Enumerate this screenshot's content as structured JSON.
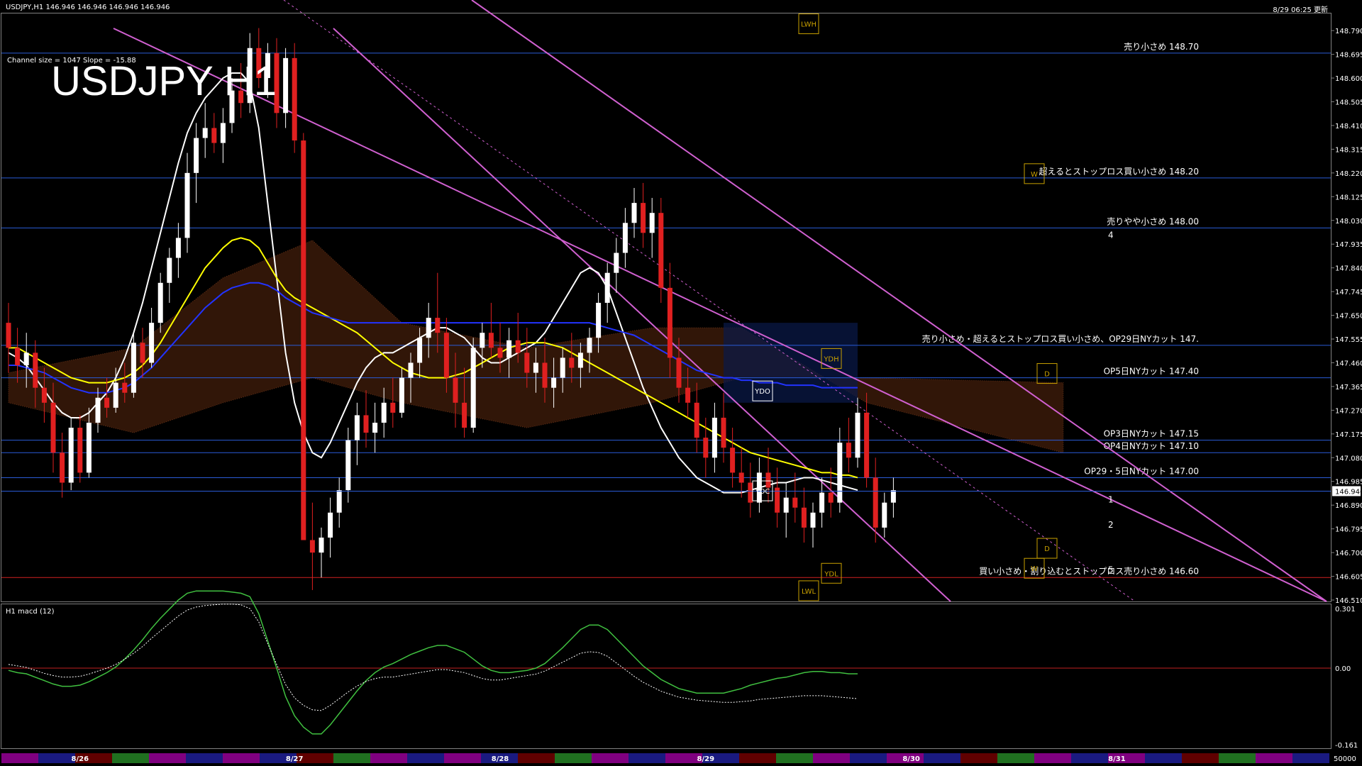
{
  "header": {
    "symbol_ohlc": "USDJPY,H1  146.946 146.946 146.946 146.946",
    "timestamp": "8/29 06:25 更新",
    "channel_info": "Channel size = 1047 Slope = -15.88",
    "title": "USDJPY H1"
  },
  "macd_panel": {
    "title": "H1  macd (12)",
    "y_labels": [
      "0.301",
      "0.00",
      "-0.161"
    ]
  },
  "volume_axis_label": "50000",
  "chart_data": {
    "type": "candlestick",
    "symbol": "USDJPY",
    "timeframe": "H1",
    "ylim": [
      146.51,
      148.85
    ],
    "y_ticks": [
      "148.790",
      "148.695",
      "148.600",
      "148.505",
      "148.410",
      "148.315",
      "148.220",
      "148.125",
      "148.030",
      "147.935",
      "147.840",
      "147.745",
      "147.650",
      "147.555",
      "147.460",
      "147.365",
      "147.270",
      "147.175",
      "147.080",
      "146.985",
      "146.890",
      "146.795",
      "146.700",
      "146.605",
      "146.510"
    ],
    "current_price": "146.946",
    "x_labels": [
      {
        "text": "8/26",
        "bar": 8
      },
      {
        "text": "8/27",
        "bar": 32
      },
      {
        "text": "8/28",
        "bar": 55
      },
      {
        "text": "8/29",
        "bar": 78
      },
      {
        "text": "8/30",
        "bar": 101
      },
      {
        "text": "8/31",
        "bar": 124
      }
    ],
    "candles": [
      [
        147.62,
        147.7,
        147.42,
        147.52
      ],
      [
        147.52,
        147.6,
        147.38,
        147.45
      ],
      [
        147.45,
        147.58,
        147.36,
        147.5
      ],
      [
        147.5,
        147.55,
        147.28,
        147.36
      ],
      [
        147.36,
        147.44,
        147.22,
        147.3
      ],
      [
        147.3,
        147.38,
        147.02,
        147.1
      ],
      [
        147.1,
        147.18,
        146.92,
        146.98
      ],
      [
        146.98,
        147.24,
        146.95,
        147.2
      ],
      [
        147.2,
        147.25,
        146.98,
        147.02
      ],
      [
        147.02,
        147.28,
        147.0,
        147.22
      ],
      [
        147.22,
        147.36,
        147.18,
        147.32
      ],
      [
        147.32,
        147.4,
        147.24,
        147.28
      ],
      [
        147.28,
        147.44,
        147.26,
        147.38
      ],
      [
        147.38,
        147.46,
        147.3,
        147.34
      ],
      [
        147.34,
        147.58,
        147.32,
        147.54
      ],
      [
        147.54,
        147.6,
        147.4,
        147.46
      ],
      [
        147.46,
        147.68,
        147.44,
        147.62
      ],
      [
        147.62,
        147.82,
        147.58,
        147.78
      ],
      [
        147.78,
        147.92,
        147.7,
        147.88
      ],
      [
        147.88,
        148.02,
        147.8,
        147.96
      ],
      [
        147.96,
        148.3,
        147.9,
        148.22
      ],
      [
        148.22,
        148.42,
        148.1,
        148.36
      ],
      [
        148.36,
        148.5,
        148.28,
        148.4
      ],
      [
        148.4,
        148.46,
        148.3,
        148.34
      ],
      [
        148.34,
        148.48,
        148.26,
        148.42
      ],
      [
        148.42,
        148.6,
        148.38,
        148.55
      ],
      [
        148.55,
        148.66,
        148.44,
        148.5
      ],
      [
        148.5,
        148.78,
        148.46,
        148.72
      ],
      [
        148.72,
        148.8,
        148.56,
        148.6
      ],
      [
        148.6,
        148.74,
        148.52,
        148.7
      ],
      [
        148.7,
        148.76,
        148.4,
        148.46
      ],
      [
        148.46,
        148.72,
        148.4,
        148.68
      ],
      [
        148.68,
        148.74,
        148.3,
        148.35
      ],
      [
        148.35,
        148.38,
        147.2,
        146.75
      ],
      [
        146.75,
        146.9,
        146.55,
        146.7
      ],
      [
        146.7,
        146.8,
        146.6,
        146.76
      ],
      [
        146.76,
        146.92,
        146.68,
        146.86
      ],
      [
        146.86,
        147.0,
        146.8,
        146.95
      ],
      [
        146.95,
        147.2,
        146.9,
        147.15
      ],
      [
        147.15,
        147.3,
        147.05,
        147.25
      ],
      [
        147.25,
        147.35,
        147.12,
        147.18
      ],
      [
        147.18,
        147.3,
        147.1,
        147.22
      ],
      [
        147.22,
        147.36,
        147.16,
        147.3
      ],
      [
        147.3,
        147.4,
        147.2,
        147.26
      ],
      [
        147.26,
        147.44,
        147.24,
        147.4
      ],
      [
        147.4,
        147.5,
        147.3,
        147.46
      ],
      [
        147.46,
        147.6,
        147.4,
        147.56
      ],
      [
        147.56,
        147.7,
        147.48,
        147.64
      ],
      [
        147.64,
        147.82,
        147.5,
        147.58
      ],
      [
        147.58,
        147.64,
        147.34,
        147.4
      ],
      [
        147.4,
        147.5,
        147.2,
        147.3
      ],
      [
        147.3,
        147.44,
        147.16,
        147.2
      ],
      [
        147.2,
        147.56,
        147.18,
        147.52
      ],
      [
        147.52,
        147.62,
        147.44,
        147.58
      ],
      [
        147.58,
        147.7,
        147.48,
        147.52
      ],
      [
        147.52,
        147.62,
        147.42,
        147.48
      ],
      [
        147.48,
        147.6,
        147.4,
        147.55
      ],
      [
        147.55,
        147.66,
        147.46,
        147.5
      ],
      [
        147.5,
        147.6,
        147.36,
        147.42
      ],
      [
        147.42,
        147.52,
        147.34,
        147.46
      ],
      [
        147.46,
        147.56,
        147.3,
        147.36
      ],
      [
        147.36,
        147.48,
        147.28,
        147.4
      ],
      [
        147.4,
        147.52,
        147.34,
        147.48
      ],
      [
        147.48,
        147.58,
        147.38,
        147.44
      ],
      [
        147.44,
        147.54,
        147.36,
        147.5
      ],
      [
        147.5,
        147.6,
        147.42,
        147.56
      ],
      [
        147.56,
        147.74,
        147.5,
        147.7
      ],
      [
        147.7,
        147.86,
        147.62,
        147.82
      ],
      [
        147.82,
        147.96,
        147.74,
        147.9
      ],
      [
        147.9,
        148.08,
        147.84,
        148.02
      ],
      [
        148.02,
        148.16,
        147.96,
        148.1
      ],
      [
        148.1,
        148.18,
        147.92,
        147.98
      ],
      [
        147.98,
        148.12,
        147.88,
        148.06
      ],
      [
        148.06,
        148.12,
        147.7,
        147.76
      ],
      [
        147.76,
        147.86,
        147.4,
        147.48
      ],
      [
        147.48,
        147.56,
        147.3,
        147.36
      ],
      [
        147.36,
        147.44,
        147.24,
        147.3
      ],
      [
        147.3,
        147.38,
        147.1,
        147.16
      ],
      [
        147.16,
        147.24,
        147.0,
        147.08
      ],
      [
        147.08,
        147.3,
        147.02,
        147.24
      ],
      [
        147.24,
        147.34,
        147.06,
        147.12
      ],
      [
        147.12,
        147.2,
        146.96,
        147.02
      ],
      [
        147.02,
        147.12,
        146.92,
        146.98
      ],
      [
        146.98,
        147.06,
        146.84,
        146.9
      ],
      [
        146.9,
        147.08,
        146.86,
        147.02
      ],
      [
        147.02,
        147.12,
        146.9,
        146.96
      ],
      [
        146.96,
        147.04,
        146.8,
        146.86
      ],
      [
        146.86,
        146.98,
        146.76,
        146.92
      ],
      [
        146.92,
        147.02,
        146.82,
        146.88
      ],
      [
        146.88,
        146.96,
        146.74,
        146.8
      ],
      [
        146.8,
        146.9,
        146.72,
        146.86
      ],
      [
        146.86,
        147.0,
        146.8,
        146.94
      ],
      [
        146.94,
        147.04,
        146.84,
        146.9
      ],
      [
        146.9,
        147.2,
        146.86,
        147.14
      ],
      [
        147.14,
        147.24,
        147.02,
        147.08
      ],
      [
        147.08,
        147.32,
        147.04,
        147.26
      ],
      [
        147.26,
        147.34,
        146.96,
        147.0
      ],
      [
        147.0,
        147.08,
        146.74,
        146.8
      ],
      [
        146.8,
        146.94,
        146.76,
        146.9
      ],
      [
        146.9,
        147.0,
        146.84,
        146.95
      ]
    ],
    "series": [
      {
        "name": "",
        "color": "#ffffff",
        "values": [
          147.5,
          147.48,
          147.45,
          147.4,
          147.35,
          147.3,
          147.26,
          147.24,
          147.24,
          147.26,
          147.3,
          147.34,
          147.4,
          147.48,
          147.58,
          147.7,
          147.84,
          147.98,
          148.12,
          148.26,
          148.38,
          148.46,
          148.52,
          148.56,
          148.6,
          148.62,
          148.62,
          148.58,
          148.4,
          148.1,
          147.8,
          147.5,
          147.3,
          147.18,
          147.1,
          147.08,
          147.14,
          147.22,
          147.3,
          147.38,
          147.44,
          147.48,
          147.5,
          147.5,
          147.52,
          147.54,
          147.56,
          147.58,
          147.6,
          147.6,
          147.58,
          147.56,
          147.52,
          147.48,
          147.46,
          147.46,
          147.48,
          147.5,
          147.52,
          147.54,
          147.58,
          147.64,
          147.7,
          147.76,
          147.82,
          147.84,
          147.82,
          147.76,
          147.66,
          147.56,
          147.46,
          147.36,
          147.28,
          147.2,
          147.14,
          147.08,
          147.04,
          147.0,
          146.98,
          146.96,
          146.94,
          146.94,
          146.94,
          146.95,
          146.96,
          146.97,
          146.98,
          146.98,
          146.99,
          147.0,
          147.0,
          146.99,
          146.98,
          146.97,
          146.96,
          146.95
        ]
      },
      {
        "name": "",
        "color": "#ffff00",
        "values": [
          147.52,
          147.52,
          147.5,
          147.48,
          147.46,
          147.44,
          147.42,
          147.4,
          147.39,
          147.38,
          147.38,
          147.38,
          147.39,
          147.4,
          147.42,
          147.45,
          147.49,
          147.54,
          147.6,
          147.66,
          147.72,
          147.78,
          147.84,
          147.88,
          147.92,
          147.95,
          147.96,
          147.95,
          147.92,
          147.86,
          147.8,
          147.75,
          147.72,
          147.7,
          147.68,
          147.66,
          147.64,
          147.62,
          147.6,
          147.58,
          147.55,
          147.52,
          147.49,
          147.46,
          147.44,
          147.42,
          147.41,
          147.4,
          147.4,
          147.4,
          147.41,
          147.42,
          147.44,
          147.46,
          147.48,
          147.5,
          147.52,
          147.53,
          147.54,
          147.54,
          147.54,
          147.53,
          147.52,
          147.5,
          147.48,
          147.46,
          147.44,
          147.42,
          147.4,
          147.38,
          147.36,
          147.34,
          147.32,
          147.3,
          147.28,
          147.26,
          147.24,
          147.22,
          147.2,
          147.18,
          147.16,
          147.14,
          147.12,
          147.1,
          147.09,
          147.08,
          147.07,
          147.06,
          147.05,
          147.04,
          147.03,
          147.02,
          147.02,
          147.01,
          147.01,
          147.0
        ]
      },
      {
        "name": "",
        "color": "#2233ff",
        "values": [
          147.45,
          147.45,
          147.44,
          147.43,
          147.42,
          147.4,
          147.38,
          147.36,
          147.35,
          147.34,
          147.34,
          147.34,
          147.35,
          147.36,
          147.38,
          147.41,
          147.44,
          147.48,
          147.52,
          147.56,
          147.6,
          147.64,
          147.68,
          147.71,
          147.74,
          147.76,
          147.77,
          147.78,
          147.78,
          147.77,
          147.75,
          147.72,
          147.7,
          147.68,
          147.66,
          147.65,
          147.64,
          147.63,
          147.62,
          147.62,
          147.62,
          147.62,
          147.62,
          147.62,
          147.62,
          147.62,
          147.62,
          147.62,
          147.62,
          147.62,
          147.62,
          147.62,
          147.62,
          147.62,
          147.62,
          147.62,
          147.62,
          147.62,
          147.62,
          147.62,
          147.62,
          147.62,
          147.62,
          147.62,
          147.62,
          147.62,
          147.61,
          147.6,
          147.59,
          147.58,
          147.57,
          147.55,
          147.53,
          147.51,
          147.49,
          147.47,
          147.45,
          147.43,
          147.42,
          147.41,
          147.4,
          147.4,
          147.39,
          147.39,
          147.38,
          147.38,
          147.38,
          147.37,
          147.37,
          147.37,
          147.37,
          147.36,
          147.36,
          147.36,
          147.36,
          147.36
        ]
      }
    ],
    "horizontal_levels": [
      {
        "price": 148.7,
        "label": "売り小さめ 148.70",
        "color": "#2a5bd7"
      },
      {
        "price": 148.2,
        "label": "超えるとストップロス買い小さめ 148.20",
        "color": "#2a5bd7"
      },
      {
        "price": 148.0,
        "label": "売りやや小さめ 148.00",
        "color": "#2a5bd7"
      },
      {
        "price": 147.53,
        "label": "売り小さめ・超えるとストップロス買い小さめ、OP29日NYカット 147.",
        "color": "#2a5bd7"
      },
      {
        "price": 147.4,
        "label": "OP5日NYカット 147.40",
        "color": "#2a5bd7"
      },
      {
        "price": 147.15,
        "label": "OP3日NYカット 147.15",
        "color": "#2a5bd7"
      },
      {
        "price": 147.1,
        "label": "OP4日NYカット 147.10",
        "color": "#2a5bd7"
      },
      {
        "price": 147.0,
        "label": "OP29・5日NYカット 147.00",
        "color": "#2a5bd7"
      },
      {
        "price": 146.6,
        "label": "買い小さめ・割り込むとストップロス売り小さめ 146.60",
        "color": "#d02020"
      }
    ],
    "markers": [
      "LWH",
      "W",
      "YDH",
      "D",
      "YDO",
      "YDC",
      "YDL",
      "LWL",
      "D",
      "W"
    ],
    "projection_labels": [
      "4",
      "1",
      "2",
      "5"
    ],
    "grid": false
  }
}
